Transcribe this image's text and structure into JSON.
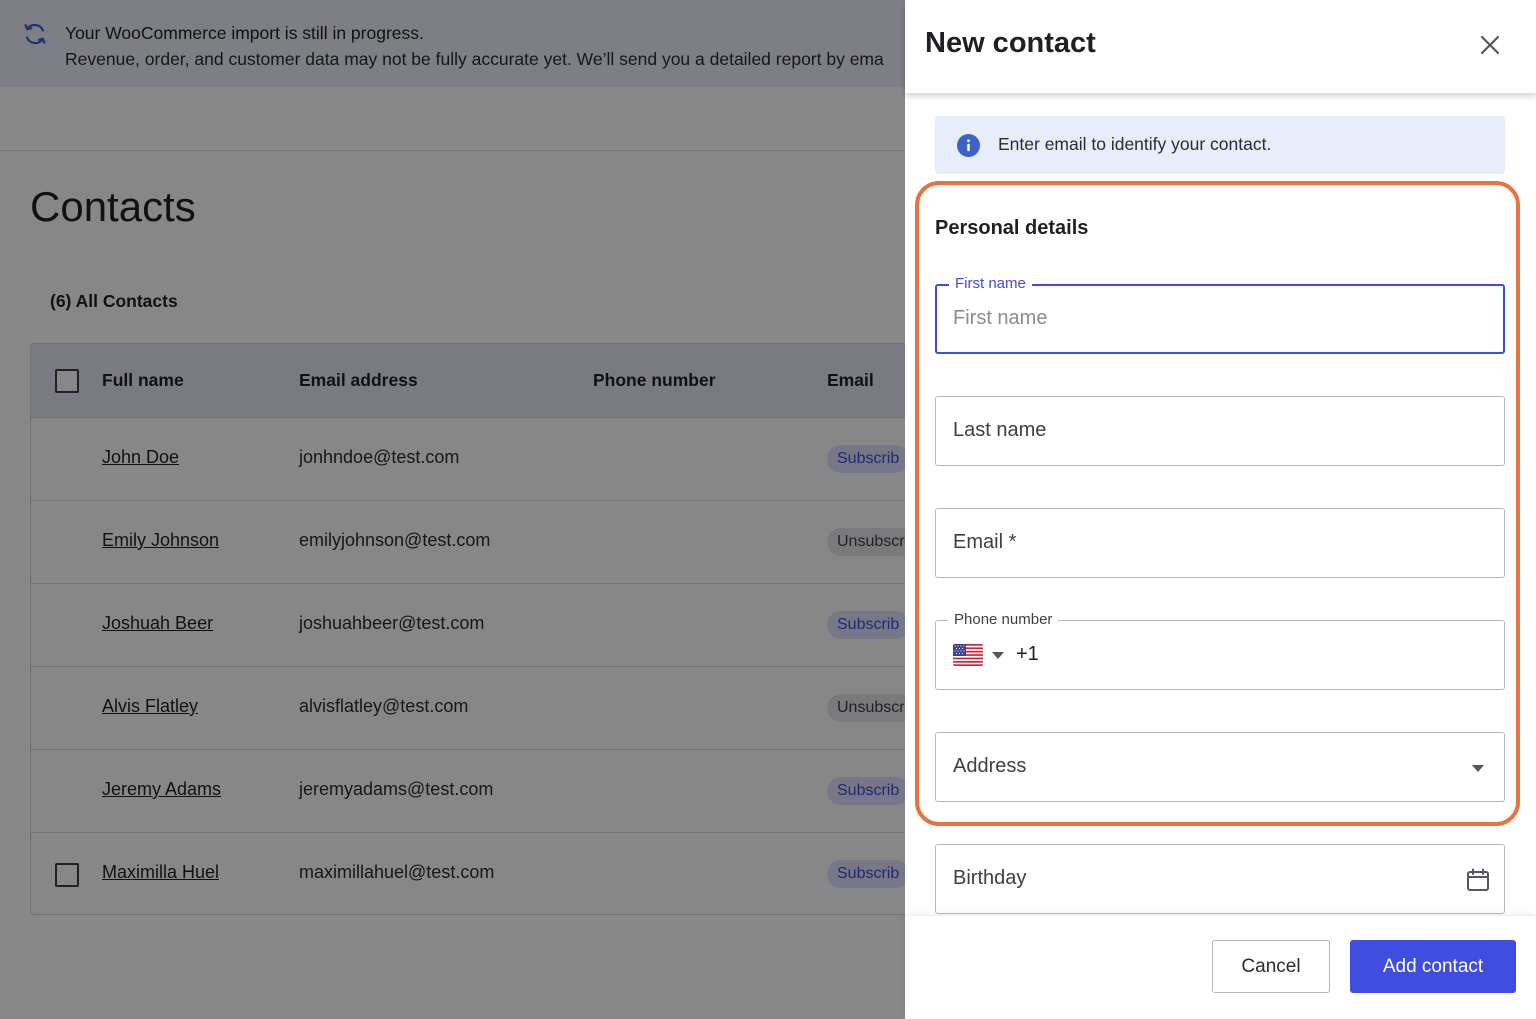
{
  "banner": {
    "title": "Your WooCommerce import is still in progress.",
    "text": "Revenue, order, and customer data may not be fully accurate yet. We’ll send you a detailed report by ema"
  },
  "page": {
    "title": "Contacts"
  },
  "contacts": {
    "count_label": "(6) All Contacts",
    "columns": {
      "full_name": "Full name",
      "email": "Email address",
      "phone": "Phone number",
      "email_status": "Email"
    },
    "rows": [
      {
        "name": "John Doe",
        "email": "jonhndoe@test.com",
        "status": "Subscrib",
        "subscribed": true,
        "checkbox": false
      },
      {
        "name": "Emily Johnson",
        "email": "emilyjohnson@test.com",
        "status": "Unsubscr",
        "subscribed": false,
        "checkbox": false
      },
      {
        "name": "Joshuah Beer",
        "email": "joshuahbeer@test.com",
        "status": "Subscrib",
        "subscribed": true,
        "checkbox": false
      },
      {
        "name": "Alvis Flatley",
        "email": "alvisflatley@test.com",
        "status": "Unsubscr",
        "subscribed": false,
        "checkbox": false
      },
      {
        "name": "Jeremy Adams",
        "email": "jeremyadams@test.com",
        "status": "Subscrib",
        "subscribed": true,
        "checkbox": false
      },
      {
        "name": "Maximilla Huel",
        "email": "maximillahuel@test.com",
        "status": "Subscrib",
        "subscribed": true,
        "checkbox": true
      }
    ]
  },
  "drawer": {
    "title": "New contact",
    "info": "Enter email to identify your contact.",
    "section_title": "Personal details",
    "fields": {
      "first_name": {
        "label": "First name",
        "placeholder": "First name"
      },
      "last_name": {
        "placeholder": "Last name"
      },
      "email": {
        "placeholder": "Email *"
      },
      "phone": {
        "label": "Phone number",
        "country": "US",
        "dial_code": "+1"
      },
      "address": {
        "placeholder": "Address"
      },
      "birthday": {
        "placeholder": "Birthday"
      }
    },
    "buttons": {
      "cancel": "Cancel",
      "submit": "Add contact"
    }
  },
  "icons": {
    "banner": "sync-icon",
    "close": "close-icon",
    "info": "info-icon",
    "calendar": "calendar-icon"
  },
  "colors": {
    "primary": "#3f4de0",
    "highlight": "#e9733f",
    "info_bg": "#e8edfb"
  }
}
